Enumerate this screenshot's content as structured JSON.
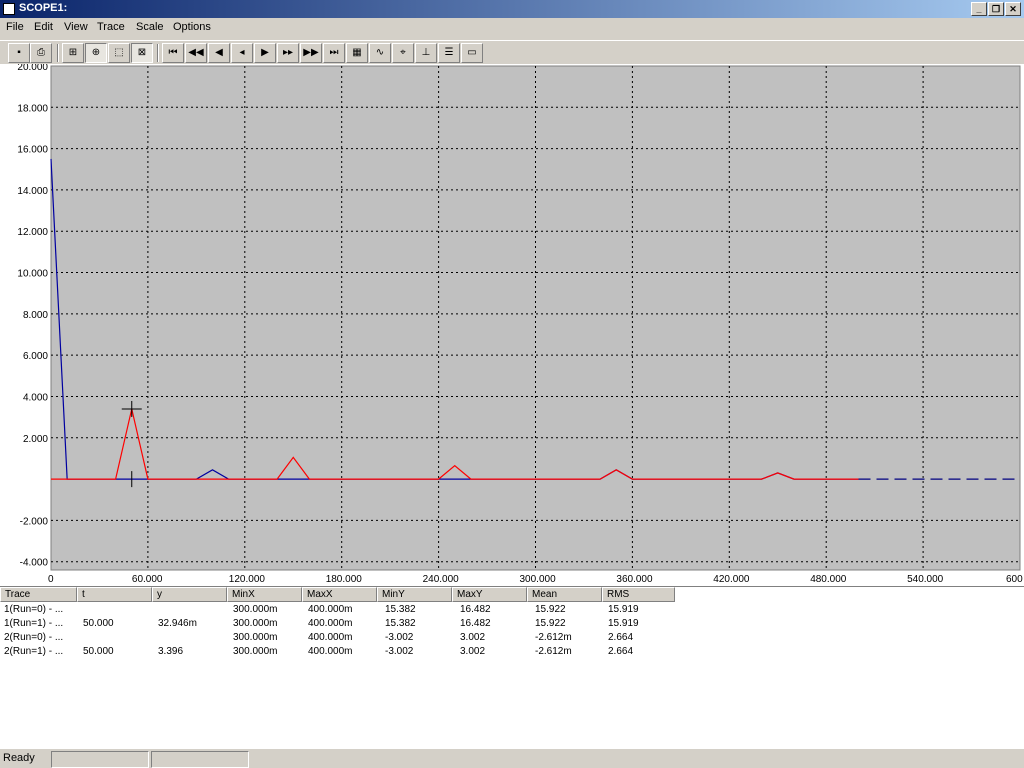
{
  "window": {
    "title": "SCOPE1:"
  },
  "menu": [
    "File",
    "Edit",
    "View",
    "Trace",
    "Scale",
    "Options"
  ],
  "colors": {
    "trace1": "#0000a0",
    "trace2": "#ff0000",
    "plot_bg": "#c0c0c0",
    "grid": "#000000"
  },
  "toolbar_icons": [
    "save-icon",
    "print-icon",
    "cursor-mode-icon",
    "zoom-fit-icon",
    "select-region-icon",
    "autoscale-icon",
    "first-icon",
    "fast-rewind-icon",
    "rewind-icon",
    "step-back-icon",
    "play-icon",
    "step-forward-icon",
    "fast-forward-icon",
    "last-icon",
    "grid-icon",
    "trace-icon",
    "cursor-icon",
    "marker-icon",
    "table-icon",
    "window-icon"
  ],
  "chart_data": {
    "type": "line",
    "x_ticks": [
      "0",
      "60.000",
      "120.000",
      "180.000",
      "240.000",
      "300.000",
      "360.000",
      "420.000",
      "480.000",
      "540.000",
      "600"
    ],
    "y_ticks": [
      "20.000",
      "18.000",
      "16.000",
      "14.000",
      "12.000",
      "10.000",
      "8.000",
      "6.000",
      "4.000",
      "2.000",
      "-2.000",
      "-4.000"
    ],
    "xlim": [
      0,
      600
    ],
    "ylim": [
      -4.4,
      20
    ],
    "grid": true,
    "cursor": {
      "x": 50,
      "y": 3.396
    },
    "series": [
      {
        "color": "#0000a0",
        "x": [
          0,
          10,
          60,
          90,
          100,
          110,
          140,
          150,
          160,
          240,
          250,
          260,
          340,
          350,
          360,
          440,
          450,
          460,
          500
        ],
        "y": [
          15.5,
          0,
          0,
          0,
          0.45,
          0,
          0,
          0,
          0,
          0,
          0,
          0,
          0,
          0.45,
          0,
          0,
          0.3,
          0,
          0
        ]
      },
      {
        "color": "#ff0000",
        "x": [
          0,
          40,
          50,
          60,
          140,
          150,
          160,
          240,
          250,
          260,
          340,
          350,
          360,
          440,
          450,
          460,
          500
        ],
        "y": [
          0,
          0,
          3.396,
          0,
          0,
          1.05,
          0,
          0,
          0.65,
          0,
          0,
          0.45,
          0,
          0,
          0.3,
          0,
          0
        ]
      }
    ]
  },
  "table": {
    "headers": [
      "Trace",
      "t",
      "y",
      "MinX",
      "MaxX",
      "MinY",
      "MaxY",
      "Mean",
      "RMS"
    ],
    "rows": [
      [
        "1(Run=0) - ...",
        "",
        "",
        "300.000m",
        "400.000m",
        "15.382",
        "16.482",
        "15.922",
        "15.919"
      ],
      [
        "1(Run=1) - ...",
        "50.000",
        "32.946m",
        "300.000m",
        "400.000m",
        "15.382",
        "16.482",
        "15.922",
        "15.919"
      ],
      [
        "2(Run=0) - ...",
        "",
        "",
        "300.000m",
        "400.000m",
        "-3.002",
        "3.002",
        "-2.612m",
        "2.664"
      ],
      [
        "2(Run=1) - ...",
        "50.000",
        "3.396",
        "300.000m",
        "400.000m",
        "-3.002",
        "3.002",
        "-2.612m",
        "2.664"
      ]
    ]
  },
  "status": {
    "text": "Ready"
  }
}
